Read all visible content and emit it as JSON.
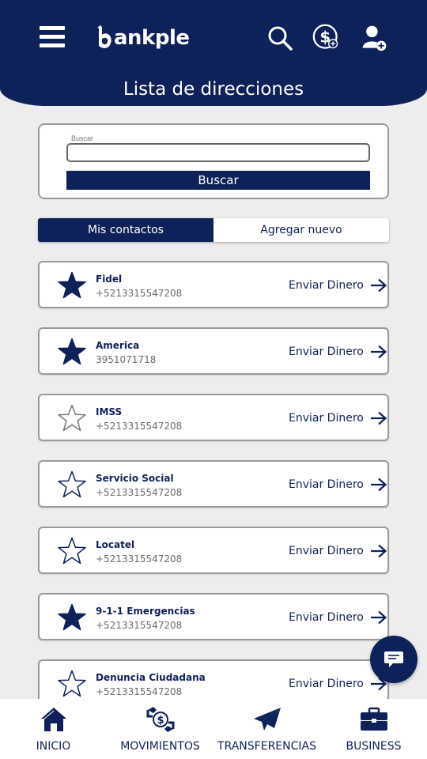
{
  "brand": {
    "logo_text": "ankple",
    "primary_color": "#0e2259",
    "background_color": "#ededed"
  },
  "header": {
    "title": "Lista de direcciones",
    "icons": [
      "menu-icon",
      "search-icon",
      "dollar-add-icon",
      "user-add-icon"
    ]
  },
  "search": {
    "label": "Buscar",
    "value": "",
    "placeholder": "",
    "button_label": "Buscar"
  },
  "tabs": [
    {
      "label": "Mis contactos",
      "active": true
    },
    {
      "label": "Agregar nuevo",
      "active": false
    }
  ],
  "send_label": "Enviar Dinero",
  "contacts": [
    {
      "name": "Fidel",
      "phone": "+5213315547208",
      "favorite": true
    },
    {
      "name": "America",
      "phone": "3951071718",
      "favorite": true
    },
    {
      "name": "IMSS",
      "phone": "+5213315547208",
      "favorite": false
    },
    {
      "name": "Servicio Social",
      "phone": "+5213315547208",
      "favorite": false
    },
    {
      "name": "Locatel",
      "phone": "+5213315547208",
      "favorite": false
    },
    {
      "name": "9-1-1 Emergencias",
      "phone": "+5213315547208",
      "favorite": true
    },
    {
      "name": "Denuncia Ciudadana",
      "phone": "+5213315547208",
      "favorite": false
    }
  ],
  "bottom_nav": [
    {
      "label": "INICIO",
      "icon": "home-icon"
    },
    {
      "label": "MOVIMIENTOS",
      "icon": "money-exchange-icon"
    },
    {
      "label": "TRANSFERENCIAS",
      "icon": "paper-plane-icon"
    },
    {
      "label": "BUSINESS",
      "icon": "briefcase-icon"
    }
  ]
}
